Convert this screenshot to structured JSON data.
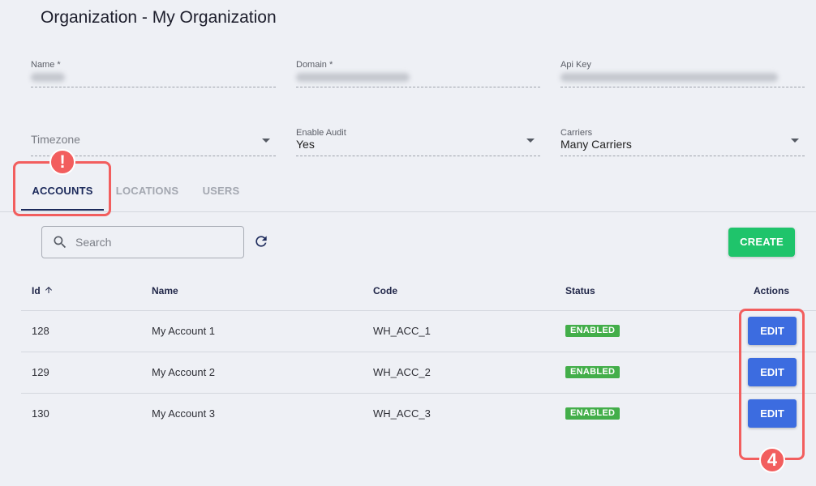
{
  "page": {
    "title": "Organization - My Organization"
  },
  "form": {
    "name": {
      "label": "Name *"
    },
    "domain": {
      "label": "Domain *"
    },
    "api_key": {
      "label": "Api Key"
    },
    "timezone": {
      "placeholder": "Timezone"
    },
    "enable_audit": {
      "label": "Enable Audit",
      "value": "Yes"
    },
    "carriers": {
      "label": "Carriers",
      "value": "Many Carriers"
    }
  },
  "tabs": [
    {
      "label": "ACCOUNTS",
      "active": true
    },
    {
      "label": "LOCATIONS",
      "active": false
    },
    {
      "label": "USERS",
      "active": false
    }
  ],
  "toolbar": {
    "search_placeholder": "Search",
    "create_label": "CREATE"
  },
  "table": {
    "columns": [
      "Id",
      "Name",
      "Code",
      "Status",
      "Actions"
    ],
    "rows": [
      {
        "id": "128",
        "name": "My Account 1",
        "code": "WH_ACC_1",
        "status": "ENABLED",
        "action": "EDIT"
      },
      {
        "id": "129",
        "name": "My Account 2",
        "code": "WH_ACC_2",
        "status": "ENABLED",
        "action": "EDIT"
      },
      {
        "id": "130",
        "name": "My Account 3",
        "code": "WH_ACC_3",
        "status": "ENABLED",
        "action": "EDIT"
      }
    ]
  },
  "annotations": {
    "tabs_marker": "!",
    "actions_marker": "4"
  },
  "icons": {
    "search": "search-icon",
    "refresh": "refresh-icon",
    "sort": "arrow-up-icon",
    "dropdown": "caret-down-icon"
  },
  "colors": {
    "background": "#eef0f5",
    "primary": "#1c2a5b",
    "create_button": "#1fc46b",
    "edit_button": "#3c6ce0",
    "status_enabled": "#43ae4a",
    "annotation": "#f25e5e"
  }
}
